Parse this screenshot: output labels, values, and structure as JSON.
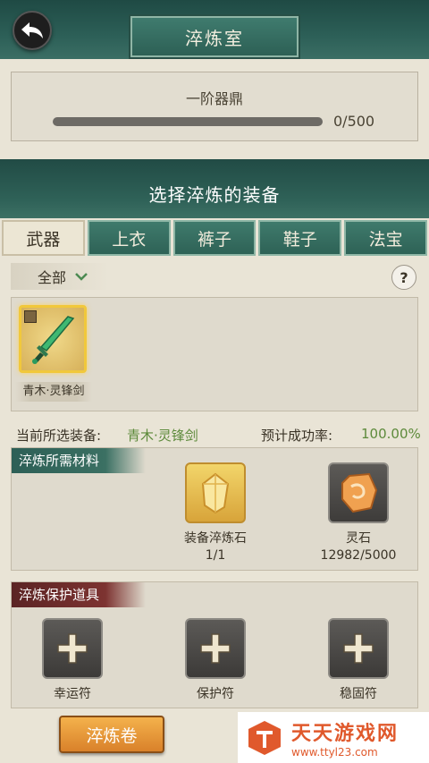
{
  "header": {
    "title": "淬炼室"
  },
  "cauldron": {
    "name": "一阶器鼎",
    "progress_text": "0/500",
    "progress_fraction": 0
  },
  "selection": {
    "title": "选择淬炼的装备"
  },
  "tabs": [
    {
      "label": "武器",
      "active": true
    },
    {
      "label": "上衣",
      "active": false
    },
    {
      "label": "裤子",
      "active": false
    },
    {
      "label": "鞋子",
      "active": false
    },
    {
      "label": "法宝",
      "active": false
    }
  ],
  "filter": {
    "label": "全部",
    "help": "?"
  },
  "items": [
    {
      "name": "青木·灵锋剑"
    }
  ],
  "info": {
    "selected_label": "当前所选装备:",
    "selected_value": "青木·灵锋剑",
    "rate_label": "预计成功率:",
    "rate_value": "100.00%"
  },
  "materials": {
    "header": "淬炼所需材料",
    "list": [
      {
        "name": "装备淬炼石",
        "count": "1/1"
      },
      {
        "name": "灵石",
        "count": "12982/5000"
      }
    ]
  },
  "protection": {
    "header": "淬炼保护道具",
    "list": [
      {
        "name": "幸运符"
      },
      {
        "name": "保护符"
      },
      {
        "name": "稳固符"
      }
    ]
  },
  "action": {
    "scroll_label": "淬炼卷"
  },
  "watermark": {
    "name": "天天游戏网",
    "url": "www.ttyl23.com"
  },
  "colors": {
    "accent_green": "#2f6258",
    "value_green": "#5d8a3b",
    "gold_border": "#f1c83b",
    "button_orange": "#d9812a",
    "watermark_orange": "#e0592c"
  },
  "icons": {
    "back": "back-arrow-icon",
    "filter": "chevron-down-icon",
    "help": "question-icon",
    "sword": "sword-icon",
    "stone": "refining-stone-icon",
    "spirit": "spirit-stone-icon",
    "plus": "plus-icon"
  }
}
